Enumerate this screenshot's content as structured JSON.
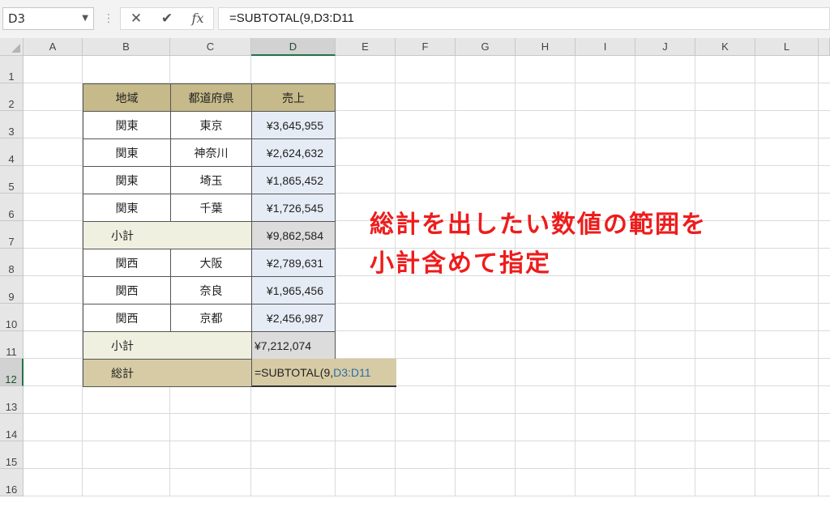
{
  "formula_bar": {
    "name_box": "D3",
    "cancel_icon": "✕",
    "enter_icon": "✔",
    "fx_label": "fx",
    "formula": "=SUBTOTAL(9,D3:D11"
  },
  "columns": [
    "A",
    "B",
    "C",
    "D",
    "E",
    "F",
    "G",
    "H",
    "I",
    "J",
    "K",
    "L"
  ],
  "selected_column": "D",
  "rows": [
    "1",
    "2",
    "3",
    "4",
    "5",
    "6",
    "7",
    "8",
    "9",
    "10",
    "11",
    "12",
    "13",
    "14",
    "15",
    "16"
  ],
  "selected_row": "12",
  "table": {
    "headers": [
      "地域",
      "都道府県",
      "売上"
    ],
    "rows": [
      {
        "region": "関東",
        "pref": "東京",
        "sales": "¥3,645,955"
      },
      {
        "region": "関東",
        "pref": "神奈川",
        "sales": "¥2,624,632"
      },
      {
        "region": "関東",
        "pref": "埼玉",
        "sales": "¥1,865,452"
      },
      {
        "region": "関東",
        "pref": "千葉",
        "sales": "¥1,726,545"
      },
      {
        "subtotal_label": "小計",
        "sales": "¥9,862,584"
      },
      {
        "region": "関西",
        "pref": "大阪",
        "sales": "¥2,789,631"
      },
      {
        "region": "関西",
        "pref": "奈良",
        "sales": "¥1,965,456"
      },
      {
        "region": "関西",
        "pref": "京都",
        "sales": "¥2,456,987"
      },
      {
        "subtotal_label": "小計",
        "sales": "¥7,212,074"
      }
    ],
    "total_label": "総計",
    "total_formula_prefix": "=SUBTOTAL(9,",
    "total_formula_ref": "D3:D11"
  },
  "annotation": {
    "line1": "総計を出したい数値の範囲を",
    "line2": "小計含めて指定"
  },
  "colors": {
    "header_fill": "#c6b98a",
    "subtotal_fill": "#f0f0e1",
    "annotation_text": "#ee1c1c",
    "selection_accent": "#217346"
  }
}
